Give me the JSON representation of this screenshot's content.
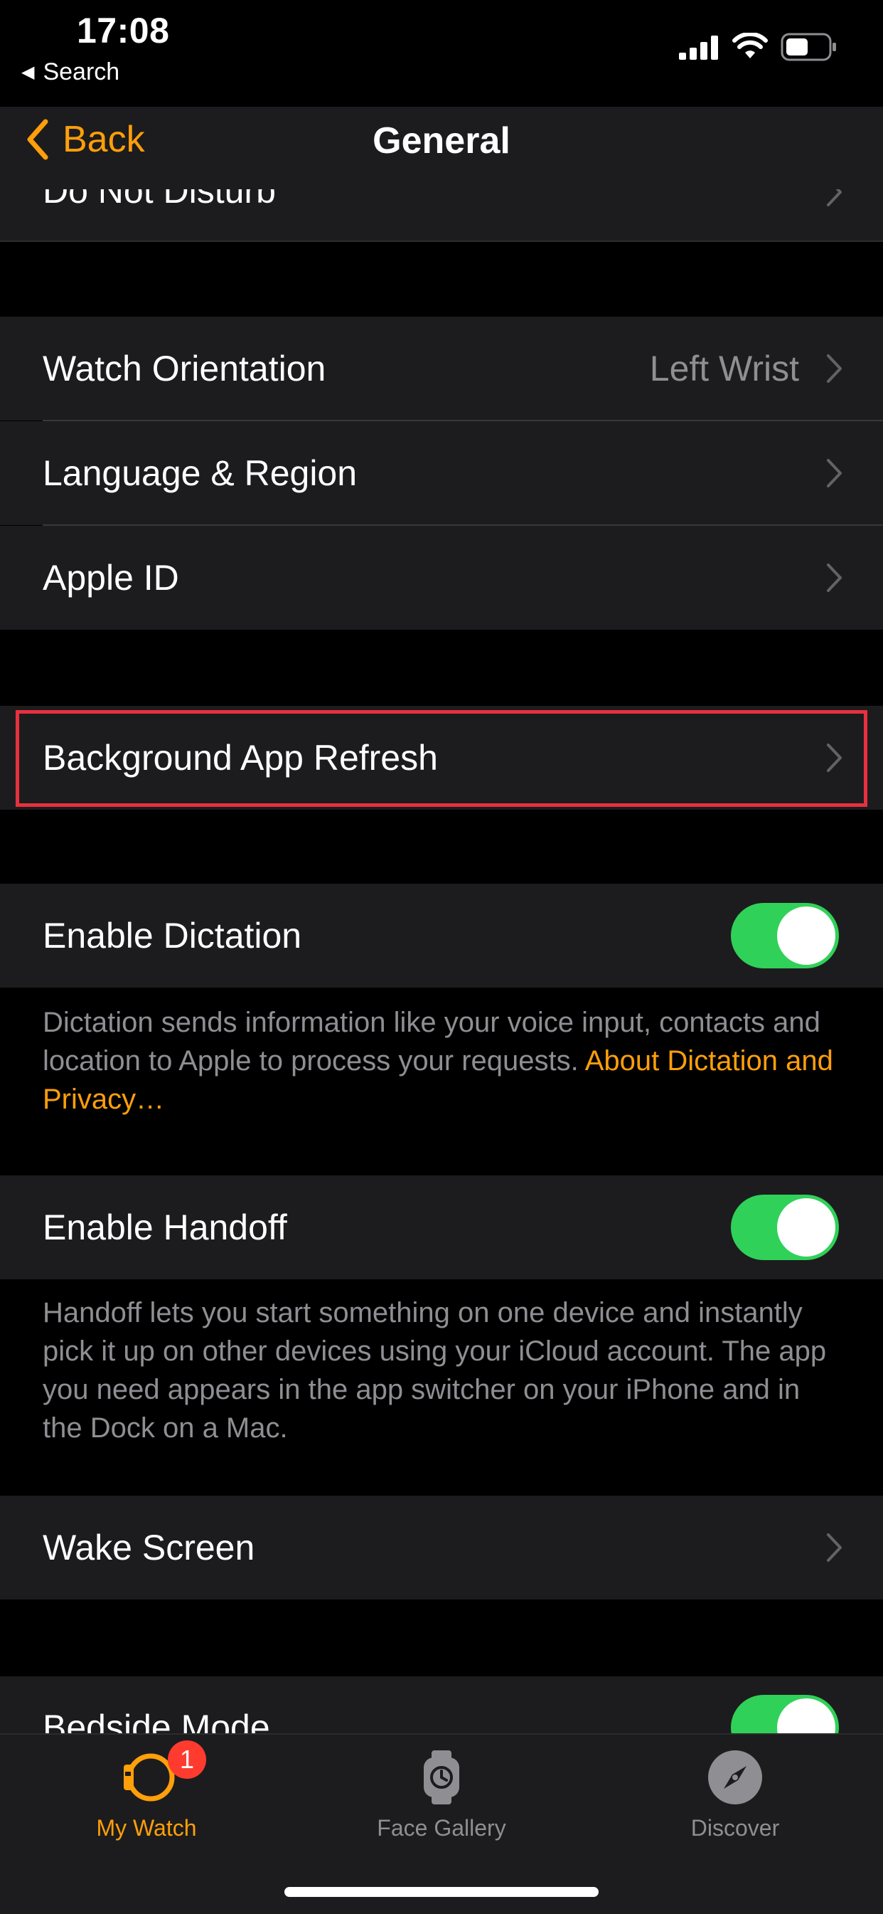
{
  "status_bar": {
    "time": "17:08",
    "back_app": "Search",
    "icons": [
      "signal-icon",
      "wifi-icon",
      "battery-icon"
    ]
  },
  "nav": {
    "back_label": "Back",
    "title": "General"
  },
  "rows": {
    "do_not_disturb": "Do Not Disturb",
    "watch_orientation": {
      "label": "Watch Orientation",
      "value": "Left Wrist"
    },
    "language_region": "Language & Region",
    "apple_id": "Apple ID",
    "background_app_refresh": "Background App Refresh",
    "enable_dictation": {
      "label": "Enable Dictation",
      "on": true
    },
    "enable_handoff": {
      "label": "Enable Handoff",
      "on": true
    },
    "wake_screen": "Wake Screen",
    "bedside_mode": {
      "label": "Bedside Mode",
      "on": true
    }
  },
  "footnotes": {
    "dictation_text": "Dictation sends information like your voice input, contacts and location to Apple to process your requests. ",
    "dictation_link": "About Dictation and Privacy…",
    "handoff_text": "Handoff lets you start something on one device and instantly pick it up on other devices using your iCloud account. The app you need appears in the app switcher on your iPhone and in the Dock on a Mac."
  },
  "tabbar": {
    "tabs": [
      {
        "label": "My Watch",
        "icon": "watch-icon",
        "active": true,
        "badge": "1"
      },
      {
        "label": "Face Gallery",
        "icon": "face-gallery-icon",
        "active": false
      },
      {
        "label": "Discover",
        "icon": "compass-icon",
        "active": false
      }
    ]
  },
  "colors": {
    "accent": "#ff9f0a",
    "toggle_on": "#30d158",
    "highlight_border": "#e8303f",
    "badge": "#ff3b30"
  }
}
